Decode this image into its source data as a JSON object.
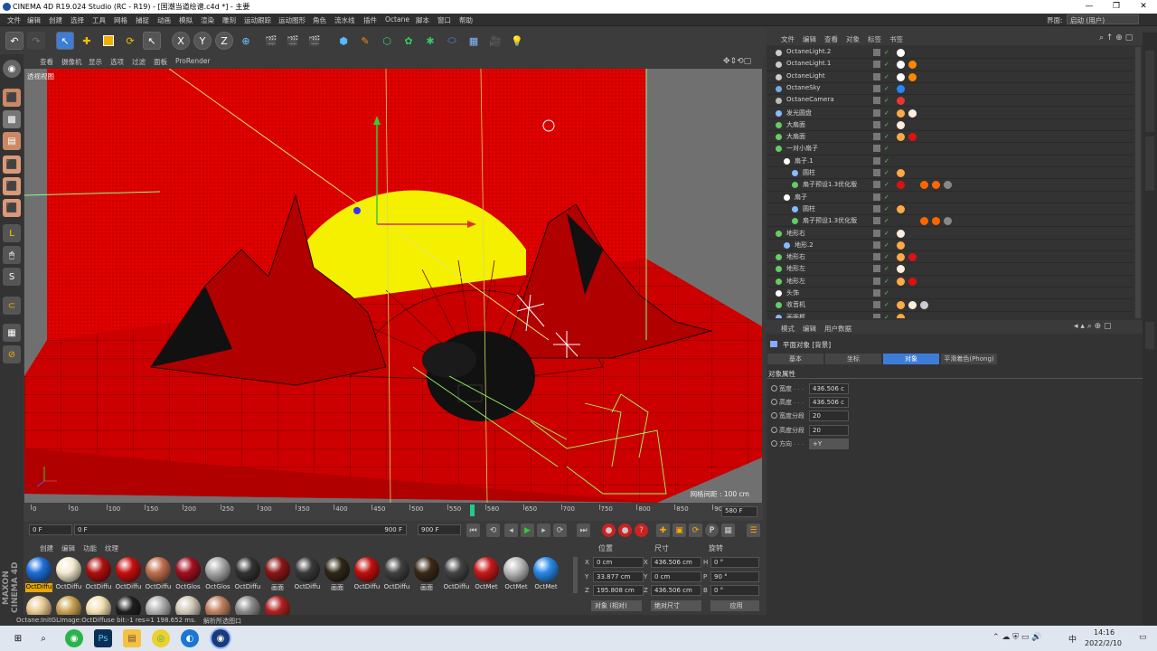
{
  "window": {
    "title": "CINEMA 4D R19.024 Studio (RC - R19) - [国潮当道绘谱.c4d *] - 主要",
    "minimize": "—",
    "maximize": "❐",
    "close": "✕"
  },
  "menubar": [
    "文件",
    "编辑",
    "创建",
    "选择",
    "工具",
    "网格",
    "捕捉",
    "动画",
    "模拟",
    "渲染",
    "雕刻",
    "运动跟踪",
    "运动图形",
    "角色",
    "流水线",
    "插件",
    "Octane",
    "脚本",
    "窗口",
    "帮助"
  ],
  "layout": {
    "label": "界面:",
    "value": "启动 (用户)"
  },
  "viewport": {
    "menu": [
      "查看",
      "摄像机",
      "显示",
      "选项",
      "过滤",
      "面板",
      "ProRender"
    ],
    "view_label": "透视视图",
    "grid_info": "网格间距 : 100 cm"
  },
  "timeline": {
    "ticks": [
      "0",
      "50",
      "100",
      "150",
      "200",
      "250",
      "300",
      "350",
      "400",
      "450",
      "500",
      "550",
      "580",
      "650",
      "700",
      "750",
      "800",
      "850",
      "90"
    ],
    "current_frame": 580,
    "end_label": "580 F"
  },
  "playbar": {
    "start": "0 F",
    "range_start": "0 F",
    "range_end": "900 F",
    "end": "900 F"
  },
  "materials": {
    "menu": [
      "创建",
      "编辑",
      "功能",
      "纹理"
    ],
    "row1": [
      {
        "label": "OctDiffu",
        "color": "#1e6fd8",
        "selected": true
      },
      {
        "label": "OctDiffu",
        "color": "#f4ecd0"
      },
      {
        "label": "OctDiffu",
        "color": "#b01010"
      },
      {
        "label": "OctDiffu",
        "color": "#c81010"
      },
      {
        "label": "OctDiffu",
        "color": "#c07050"
      },
      {
        "label": "OctGlos",
        "color": "#a01020"
      },
      {
        "label": "OctGlos",
        "color": "#aaaaaa"
      },
      {
        "label": "OctDiffu",
        "color": "#333333"
      },
      {
        "label": "画面",
        "color": "#8a1818"
      },
      {
        "label": "OctDiffu",
        "color": "#3a3a3a"
      },
      {
        "label": "画面",
        "color": "#302818"
      },
      {
        "label": "OctDiffu",
        "color": "#c01010"
      },
      {
        "label": "OctDiffu",
        "color": "#404040"
      },
      {
        "label": "画面",
        "color": "#3a2a18"
      },
      {
        "label": "OctDiffu",
        "color": "#444444"
      },
      {
        "label": "OctMet",
        "color": "#c81a1a"
      },
      {
        "label": "OctMet",
        "color": "#bbbbbb"
      },
      {
        "label": "OctMet",
        "color": "#2a8ae8"
      }
    ],
    "row2": [
      {
        "color": "#e8c890"
      },
      {
        "color": "#c8a050"
      },
      {
        "color": "#f0e0b0"
      },
      {
        "color": "#202020"
      },
      {
        "color": "#b0b0b0"
      },
      {
        "color": "#d0c8b8"
      },
      {
        "color": "#c08060"
      },
      {
        "color": "#8a8a8a"
      },
      {
        "color": "#b02020"
      }
    ]
  },
  "coordinates": {
    "headers": [
      "位置",
      "尺寸",
      "旋转"
    ],
    "rows": [
      {
        "axis": "X",
        "pos": "0 cm",
        "size_axis": "X",
        "size": "436.506 cm",
        "rot_axis": "H",
        "rot": "0 °"
      },
      {
        "axis": "Y",
        "pos": "33.877 cm",
        "size_axis": "Y",
        "size": "0 cm",
        "rot_axis": "P",
        "rot": "90 °"
      },
      {
        "axis": "Z",
        "pos": "195.808 cm",
        "size_axis": "Z",
        "size": "436.506 cm",
        "rot_axis": "B",
        "rot": "0 °"
      }
    ],
    "mode": "对象 (相对)",
    "size_mode": "绝对尺寸",
    "apply": "应用"
  },
  "status": {
    "text": "Octane:InitGLImage:OctDiffuse  bit:-1 res=1  198.652 ms.",
    "hint": "解析所选图口"
  },
  "object_manager": {
    "menu": [
      "文件",
      "编辑",
      "查看",
      "对象",
      "标签",
      "书签"
    ],
    "objects": [
      {
        "name": "OctaneLight.2",
        "indent": 0
      },
      {
        "name": "OctaneLight.1",
        "indent": 0
      },
      {
        "name": "OctaneLight",
        "indent": 0
      },
      {
        "name": "OctaneSky",
        "indent": 0
      },
      {
        "name": "OctaneCamera",
        "indent": 0
      },
      {
        "name": "发光圆盘",
        "indent": 0
      },
      {
        "name": "大扇面",
        "indent": 0
      },
      {
        "name": "大扇面",
        "indent": 0
      },
      {
        "name": "一对小扇子",
        "indent": 0
      },
      {
        "name": "扇子.1",
        "indent": 1
      },
      {
        "name": "圆柱",
        "indent": 2
      },
      {
        "name": "扇子预设1.3优化版",
        "indent": 2
      },
      {
        "name": "扇子",
        "indent": 1
      },
      {
        "name": "圆柱",
        "indent": 2
      },
      {
        "name": "扇子预设1.3优化版",
        "indent": 2
      },
      {
        "name": "地形右",
        "indent": 0
      },
      {
        "name": "地形.2",
        "indent": 1
      },
      {
        "name": "地形右",
        "indent": 0
      },
      {
        "name": "地形左",
        "indent": 0
      },
      {
        "name": "地形左",
        "indent": 0
      },
      {
        "name": "头饰",
        "indent": 0
      },
      {
        "name": "收音机",
        "indent": 0
      },
      {
        "name": "画面框",
        "indent": 0
      }
    ]
  },
  "attribute_manager": {
    "menu": [
      "模式",
      "编辑",
      "用户数据"
    ],
    "object_title": "平面对象 [背景]",
    "tabs": [
      "基本",
      "坐标",
      "对象",
      "平滑着色(Phong)"
    ],
    "active_tab": "对象",
    "section": "对象属性",
    "props": [
      {
        "label": "宽度",
        "value": "436.506 c"
      },
      {
        "label": "高度",
        "value": "436.506 c"
      },
      {
        "label": "宽度分段",
        "value": "20"
      },
      {
        "label": "高度分段",
        "value": "20"
      },
      {
        "label": "方向",
        "value": "+Y"
      }
    ]
  },
  "taskbar": {
    "time": "14:16",
    "date": "2022/2/10",
    "ime": "中"
  }
}
